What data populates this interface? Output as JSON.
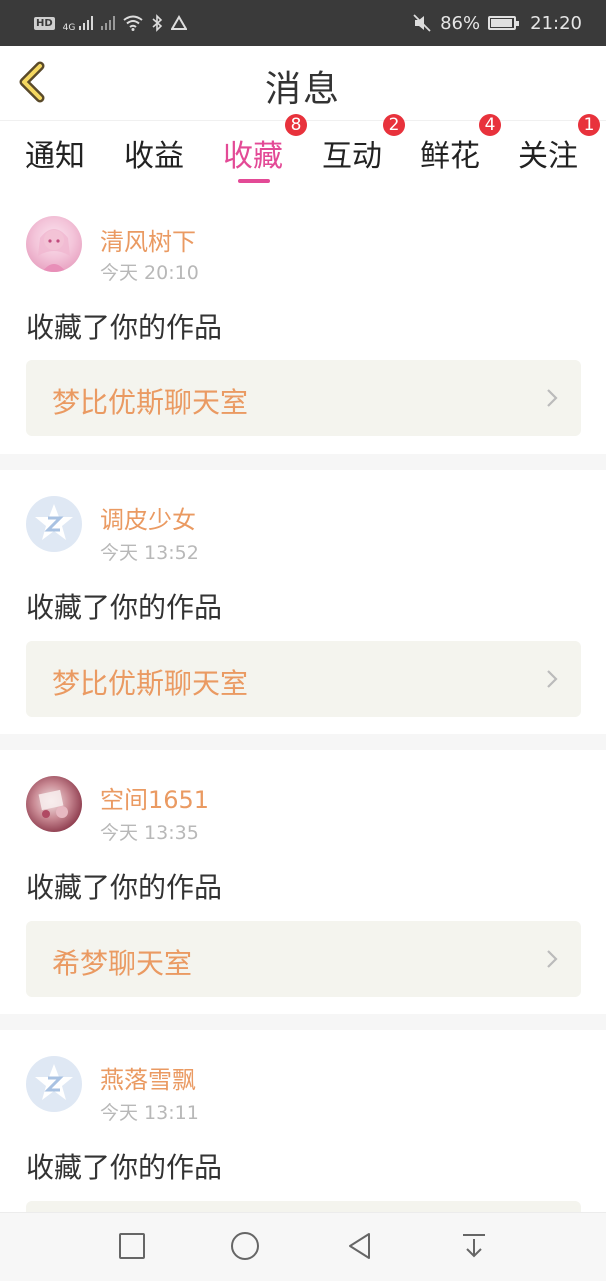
{
  "status_bar": {
    "network": "4G",
    "battery": "86%",
    "time": "21:20",
    "icons": [
      "hd-icon",
      "signal-icon",
      "wifi-icon",
      "bluetooth-icon",
      "alert-icon",
      "mute-icon",
      "battery-icon"
    ],
    "battery_level": 0.86
  },
  "header": {
    "title": "消息",
    "back_icon": "chevron-left-icon"
  },
  "tabs": [
    {
      "label": "通知",
      "badge": ""
    },
    {
      "label": "收益",
      "badge": ""
    },
    {
      "label": "收藏",
      "badge": "8"
    },
    {
      "label": "互动",
      "badge": "2"
    },
    {
      "label": "鲜花",
      "badge": "4"
    },
    {
      "label": "关注",
      "badge": "1"
    }
  ],
  "active_tab": "收藏",
  "colors": {
    "accent": "#e34a96",
    "name": "#ea9a62",
    "badge": "#e8323c",
    "work_bg": "#f4f4ee"
  },
  "items": [
    {
      "user": "清风树下",
      "time": "今天 20:10",
      "message": "收藏了你的作品",
      "work": "梦比优斯聊天室"
    },
    {
      "user": "调皮少女",
      "time": "今天 13:52",
      "message": "收藏了你的作品",
      "work": "梦比优斯聊天室"
    },
    {
      "user": "空间1651",
      "time": "今天 13:35",
      "message": "收藏了你的作品",
      "work": "希梦聊天室"
    },
    {
      "user": "燕落雪飘",
      "time": "今天 13:11",
      "message": "收藏了你的作品",
      "work": ""
    }
  ],
  "nav_bar": {
    "icons": [
      "square-icon",
      "circle-icon",
      "triangle-back-icon",
      "download-icon"
    ]
  }
}
